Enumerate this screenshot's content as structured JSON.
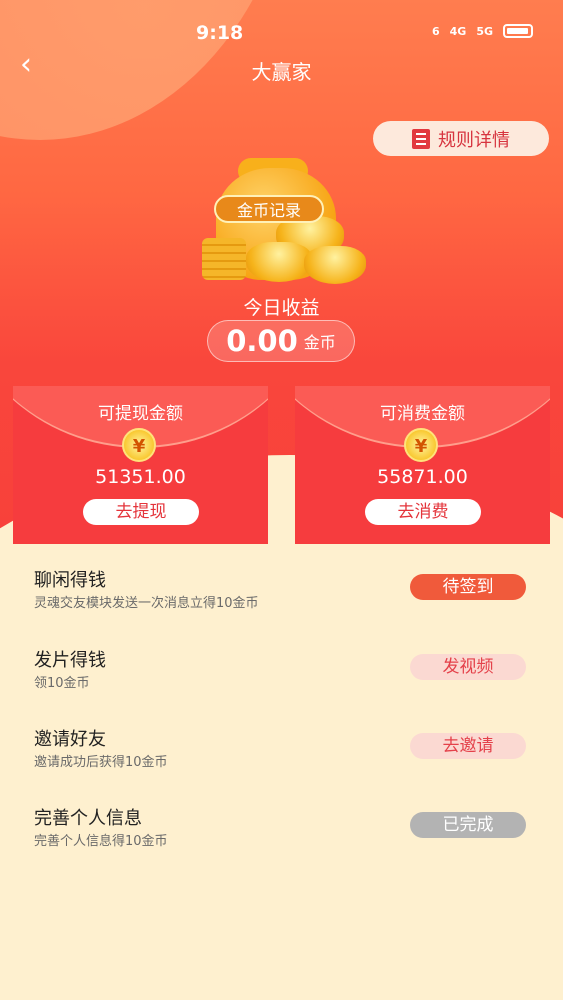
{
  "status_bar": {
    "time": "9:18",
    "net_a": "6",
    "net_b": "4G",
    "net_c": "5G"
  },
  "nav": {
    "back_glyph": "‹",
    "title": "大赢家"
  },
  "rules_button": {
    "label": "规则详情",
    "icon": "book-icon"
  },
  "coins_record": {
    "label": "金币记录"
  },
  "today": {
    "label": "今日收益",
    "value": "0.00",
    "unit": "金币"
  },
  "cards": [
    {
      "title": "可提现金额",
      "amount": "51351.00",
      "button": "去提现",
      "coin_glyph": "¥"
    },
    {
      "title": "可消费金额",
      "amount": "55871.00",
      "button": "去消费",
      "coin_glyph": "¥"
    }
  ],
  "tasks": [
    {
      "title": "聊闲得钱",
      "desc": "灵魂交友模块发送一次消息立得10金币",
      "button": "待签到",
      "style": "red"
    },
    {
      "title": "发片得钱",
      "desc": "领10金币",
      "button": "发视频",
      "style": "pink"
    },
    {
      "title": "邀请好友",
      "desc": "邀请成功后获得10金币",
      "button": "去邀请",
      "style": "pink"
    },
    {
      "title": "完善个人信息",
      "desc": "完善个人信息得10金币",
      "button": "已完成",
      "style": "gray"
    }
  ],
  "colors": {
    "primary_red": "#f63c3e",
    "accent_orange": "#f05a3b",
    "cream_bg": "#fef0cf"
  }
}
